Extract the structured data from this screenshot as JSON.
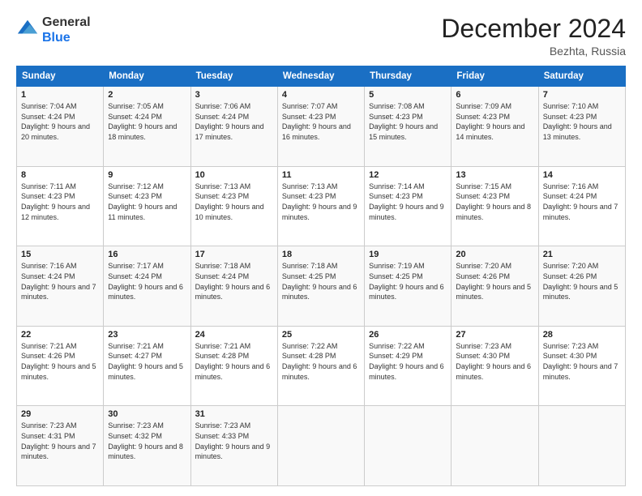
{
  "logo": {
    "general": "General",
    "blue": "Blue"
  },
  "header": {
    "month": "December 2024",
    "location": "Bezhta, Russia"
  },
  "weekdays": [
    "Sunday",
    "Monday",
    "Tuesday",
    "Wednesday",
    "Thursday",
    "Friday",
    "Saturday"
  ],
  "weeks": [
    [
      {
        "day": "1",
        "sunrise": "7:04 AM",
        "sunset": "4:24 PM",
        "daylight": "9 hours and 20 minutes."
      },
      {
        "day": "2",
        "sunrise": "7:05 AM",
        "sunset": "4:24 PM",
        "daylight": "9 hours and 18 minutes."
      },
      {
        "day": "3",
        "sunrise": "7:06 AM",
        "sunset": "4:24 PM",
        "daylight": "9 hours and 17 minutes."
      },
      {
        "day": "4",
        "sunrise": "7:07 AM",
        "sunset": "4:23 PM",
        "daylight": "9 hours and 16 minutes."
      },
      {
        "day": "5",
        "sunrise": "7:08 AM",
        "sunset": "4:23 PM",
        "daylight": "9 hours and 15 minutes."
      },
      {
        "day": "6",
        "sunrise": "7:09 AM",
        "sunset": "4:23 PM",
        "daylight": "9 hours and 14 minutes."
      },
      {
        "day": "7",
        "sunrise": "7:10 AM",
        "sunset": "4:23 PM",
        "daylight": "9 hours and 13 minutes."
      }
    ],
    [
      {
        "day": "8",
        "sunrise": "7:11 AM",
        "sunset": "4:23 PM",
        "daylight": "9 hours and 12 minutes."
      },
      {
        "day": "9",
        "sunrise": "7:12 AM",
        "sunset": "4:23 PM",
        "daylight": "9 hours and 11 minutes."
      },
      {
        "day": "10",
        "sunrise": "7:13 AM",
        "sunset": "4:23 PM",
        "daylight": "9 hours and 10 minutes."
      },
      {
        "day": "11",
        "sunrise": "7:13 AM",
        "sunset": "4:23 PM",
        "daylight": "9 hours and 9 minutes."
      },
      {
        "day": "12",
        "sunrise": "7:14 AM",
        "sunset": "4:23 PM",
        "daylight": "9 hours and 9 minutes."
      },
      {
        "day": "13",
        "sunrise": "7:15 AM",
        "sunset": "4:23 PM",
        "daylight": "9 hours and 8 minutes."
      },
      {
        "day": "14",
        "sunrise": "7:16 AM",
        "sunset": "4:24 PM",
        "daylight": "9 hours and 7 minutes."
      }
    ],
    [
      {
        "day": "15",
        "sunrise": "7:16 AM",
        "sunset": "4:24 PM",
        "daylight": "9 hours and 7 minutes."
      },
      {
        "day": "16",
        "sunrise": "7:17 AM",
        "sunset": "4:24 PM",
        "daylight": "9 hours and 6 minutes."
      },
      {
        "day": "17",
        "sunrise": "7:18 AM",
        "sunset": "4:24 PM",
        "daylight": "9 hours and 6 minutes."
      },
      {
        "day": "18",
        "sunrise": "7:18 AM",
        "sunset": "4:25 PM",
        "daylight": "9 hours and 6 minutes."
      },
      {
        "day": "19",
        "sunrise": "7:19 AM",
        "sunset": "4:25 PM",
        "daylight": "9 hours and 6 minutes."
      },
      {
        "day": "20",
        "sunrise": "7:20 AM",
        "sunset": "4:26 PM",
        "daylight": "9 hours and 5 minutes."
      },
      {
        "day": "21",
        "sunrise": "7:20 AM",
        "sunset": "4:26 PM",
        "daylight": "9 hours and 5 minutes."
      }
    ],
    [
      {
        "day": "22",
        "sunrise": "7:21 AM",
        "sunset": "4:26 PM",
        "daylight": "9 hours and 5 minutes."
      },
      {
        "day": "23",
        "sunrise": "7:21 AM",
        "sunset": "4:27 PM",
        "daylight": "9 hours and 5 minutes."
      },
      {
        "day": "24",
        "sunrise": "7:21 AM",
        "sunset": "4:28 PM",
        "daylight": "9 hours and 6 minutes."
      },
      {
        "day": "25",
        "sunrise": "7:22 AM",
        "sunset": "4:28 PM",
        "daylight": "9 hours and 6 minutes."
      },
      {
        "day": "26",
        "sunrise": "7:22 AM",
        "sunset": "4:29 PM",
        "daylight": "9 hours and 6 minutes."
      },
      {
        "day": "27",
        "sunrise": "7:23 AM",
        "sunset": "4:30 PM",
        "daylight": "9 hours and 6 minutes."
      },
      {
        "day": "28",
        "sunrise": "7:23 AM",
        "sunset": "4:30 PM",
        "daylight": "9 hours and 7 minutes."
      }
    ],
    [
      {
        "day": "29",
        "sunrise": "7:23 AM",
        "sunset": "4:31 PM",
        "daylight": "9 hours and 7 minutes."
      },
      {
        "day": "30",
        "sunrise": "7:23 AM",
        "sunset": "4:32 PM",
        "daylight": "9 hours and 8 minutes."
      },
      {
        "day": "31",
        "sunrise": "7:23 AM",
        "sunset": "4:33 PM",
        "daylight": "9 hours and 9 minutes."
      },
      null,
      null,
      null,
      null
    ]
  ]
}
